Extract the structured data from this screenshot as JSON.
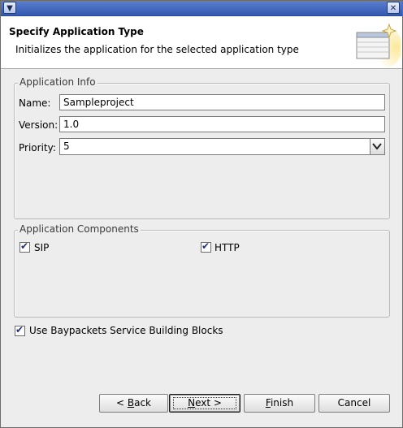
{
  "header": {
    "title": "Specify Application Type",
    "description": "Initializes the application for the selected application type"
  },
  "app_info": {
    "group_title": "Application Info",
    "name_label": "Name:",
    "name_value": "Sampleproject",
    "version_label": "Version:",
    "version_value": "1.0",
    "priority_label": "Priority:",
    "priority_value": "5"
  },
  "components": {
    "group_title": "Application Components",
    "sip_label": "SIP",
    "sip_checked": true,
    "http_label": "HTTP",
    "http_checked": true
  },
  "building_blocks": {
    "label": "Use Baypackets Service Building Blocks",
    "checked": true
  },
  "buttons": {
    "back_prefix": "< ",
    "back_mnemonic": "B",
    "back_rest": "ack",
    "next_mnemonic": "N",
    "next_rest": "ext >",
    "finish_mnemonic": "F",
    "finish_rest": "inish",
    "cancel": "Cancel"
  },
  "icons": {
    "menu": "chevron-down-icon",
    "close": "close-icon",
    "wizard": "wizard-window-sparkle-icon",
    "dropdown": "triangle-down-icon",
    "check": "check-icon"
  }
}
